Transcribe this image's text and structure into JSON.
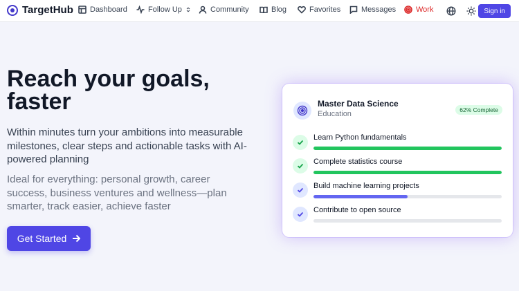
{
  "nav": {
    "brand": "TargetHub",
    "items": [
      {
        "label": "Dashboard",
        "icon": "dashboard-icon"
      },
      {
        "label": "Follow Up",
        "icon": "activity-icon"
      },
      {
        "label": "Community",
        "icon": "user-icon"
      },
      {
        "label": "Blog",
        "icon": "book-icon"
      },
      {
        "label": "Favorites",
        "icon": "heart-icon"
      },
      {
        "label": "Messages",
        "icon": "message-icon"
      },
      {
        "label": "Work",
        "icon": "target-icon"
      }
    ],
    "signin_label": "Sign in"
  },
  "hero": {
    "title": "Reach your goals, faster",
    "subtitle": "Within minutes turn your ambitions into measurable milestones, clear steps and actionable tasks with AI-powered planning",
    "subtitle2": "Ideal for everything: personal growth, career success, business ventures and wellness—plan smarter, track easier, achieve faster",
    "cta_label": "Get Started"
  },
  "card": {
    "title": "Master Data Science",
    "category": "Education",
    "badge": "62% Complete",
    "tasks": [
      {
        "label": "Learn Python fundamentals",
        "progress": 1.0,
        "status": "done"
      },
      {
        "label": "Complete statistics course",
        "progress": 1.0,
        "status": "done"
      },
      {
        "label": "Build machine learning projects",
        "progress": 0.5,
        "status": "in-progress"
      },
      {
        "label": "Contribute to open source",
        "progress": 0.0,
        "status": "todo"
      }
    ]
  },
  "colors": {
    "accent": "#4f46e5",
    "done": "#22c55e",
    "in_progress": "#6366f1",
    "work": "#dc2626"
  }
}
